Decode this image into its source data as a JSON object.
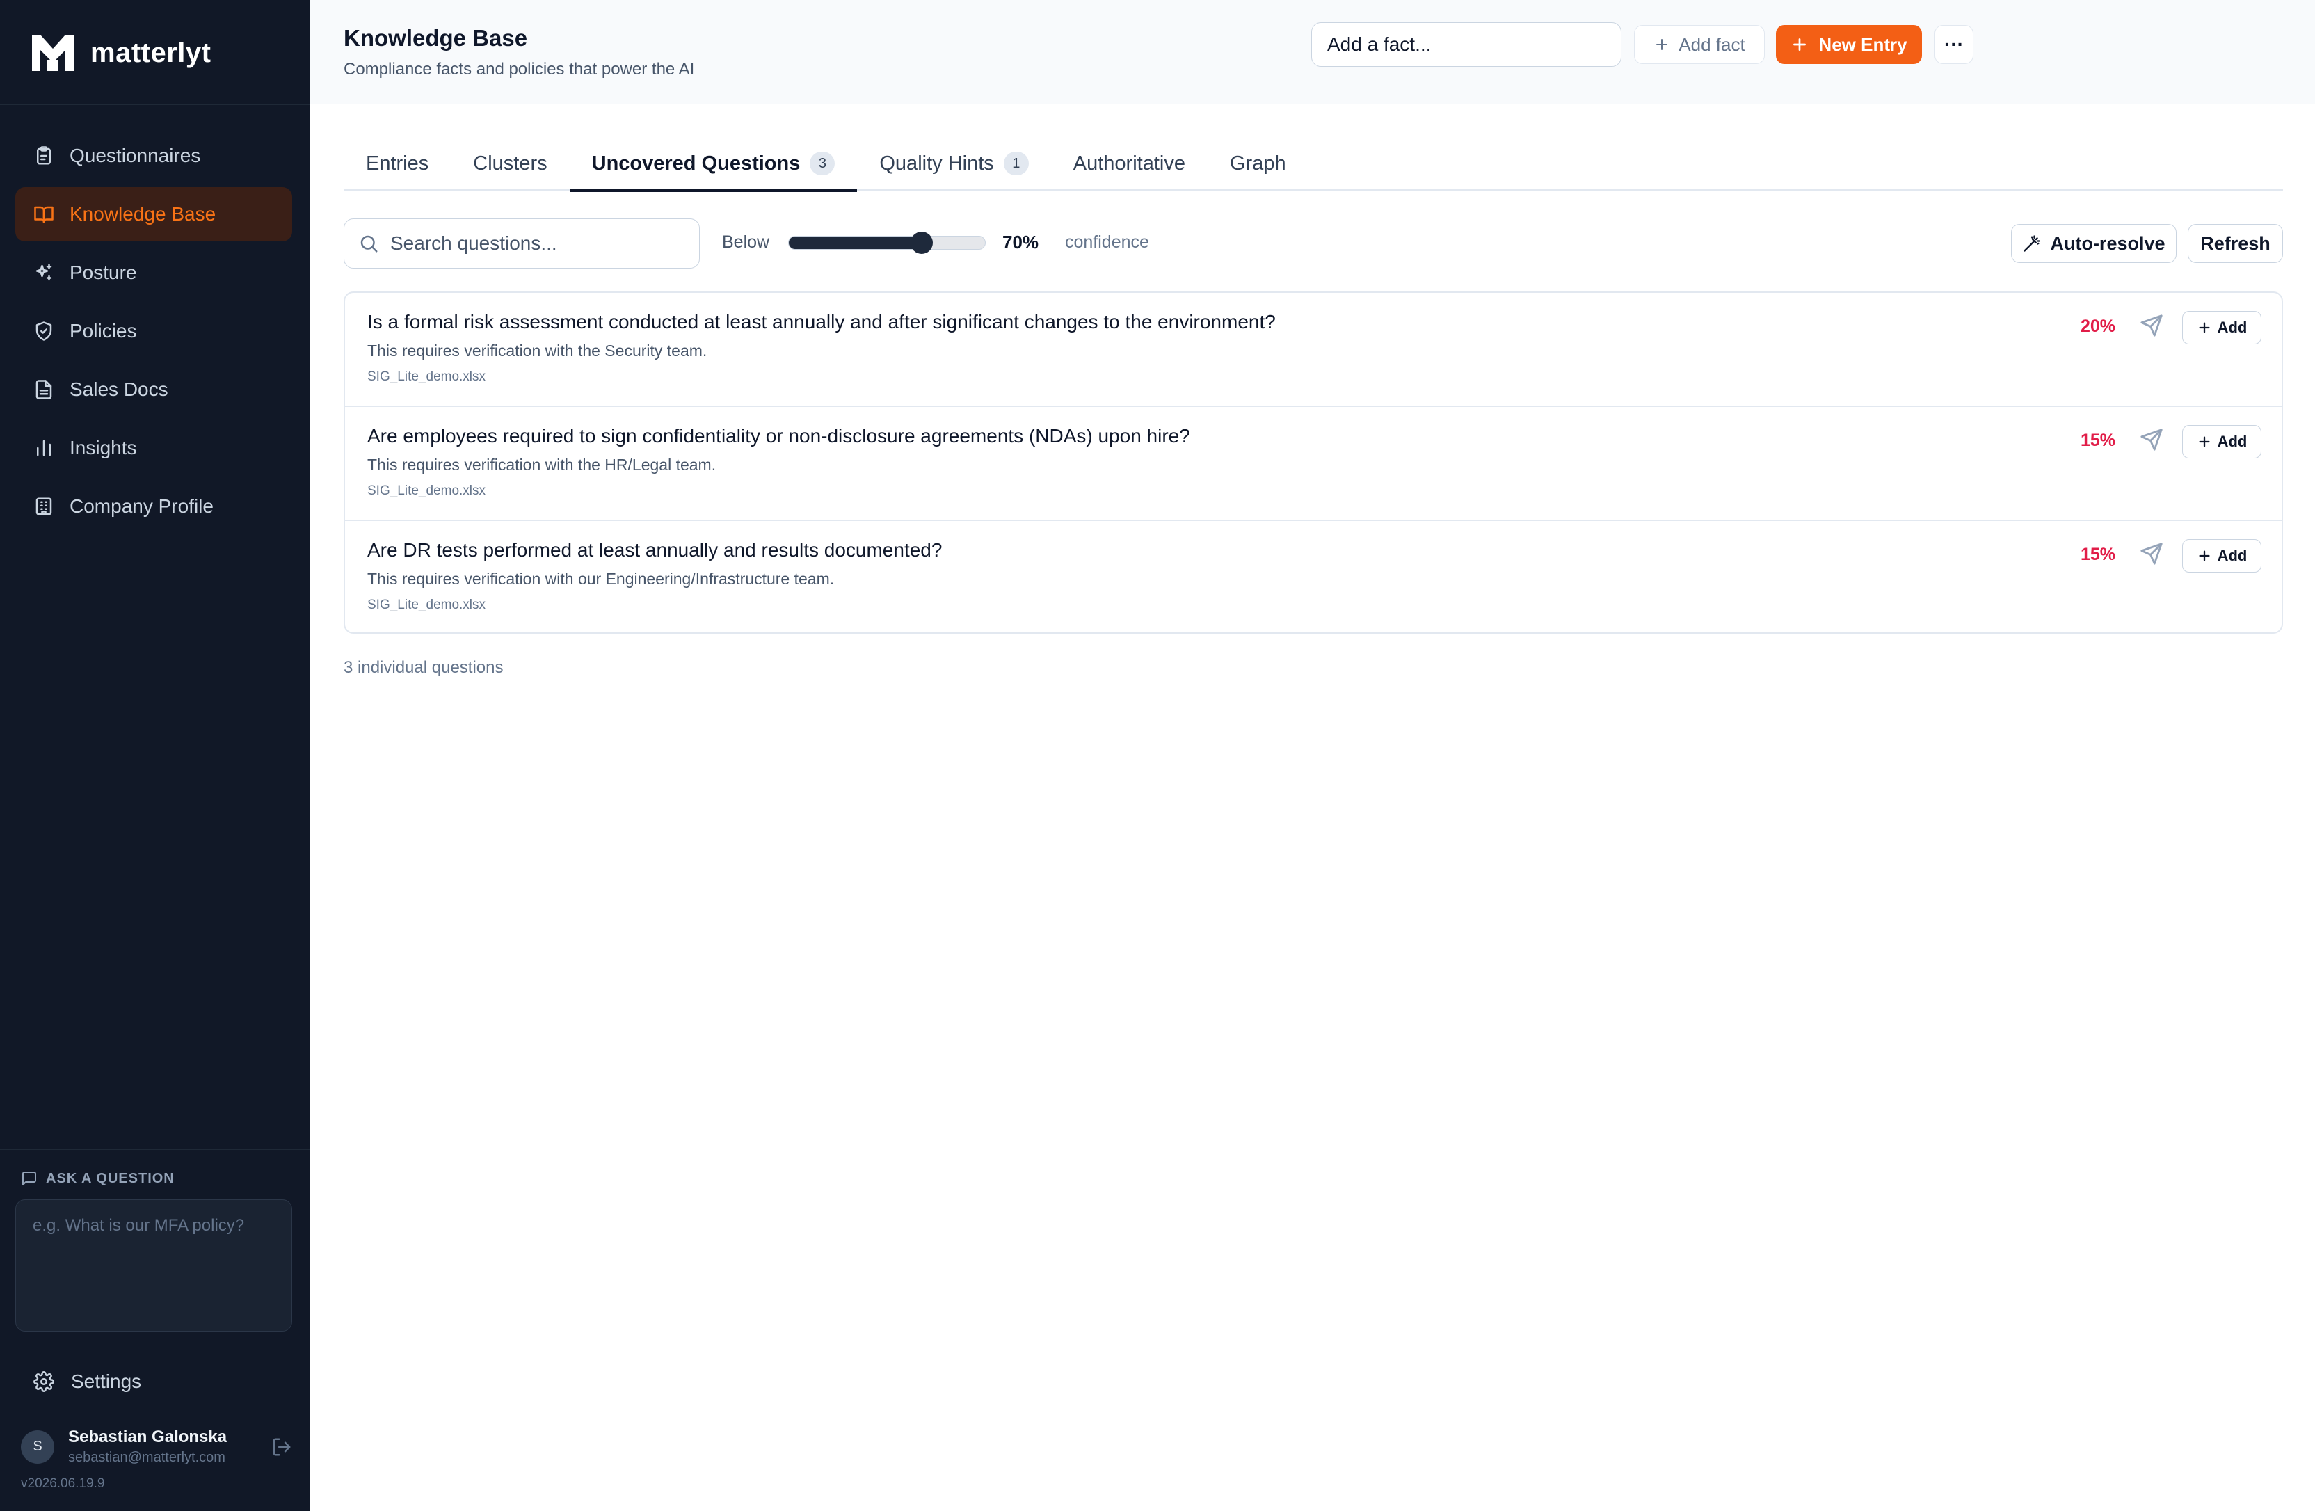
{
  "brand": {
    "name": "matterlyt"
  },
  "sidebar": {
    "items": [
      {
        "label": "Questionnaires",
        "icon": "clipboard-icon",
        "active": false
      },
      {
        "label": "Knowledge Base",
        "icon": "book-open-icon",
        "active": true
      },
      {
        "label": "Posture",
        "icon": "sparkles-icon",
        "active": false
      },
      {
        "label": "Policies",
        "icon": "shield-icon",
        "active": false
      },
      {
        "label": "Sales Docs",
        "icon": "file-text-icon",
        "active": false
      },
      {
        "label": "Insights",
        "icon": "bar-chart-icon",
        "active": false
      },
      {
        "label": "Company Profile",
        "icon": "building-icon",
        "active": false
      }
    ],
    "ask": {
      "label": "ASK A QUESTION",
      "placeholder": "e.g. What is our MFA policy?"
    },
    "settings_label": "Settings",
    "user": {
      "initial": "S",
      "name": "Sebastian Galonska",
      "email": "sebastian@matterlyt.com"
    },
    "version": "v2026.06.19.9"
  },
  "header": {
    "title": "Knowledge Base",
    "subtitle": "Compliance facts and policies that power the AI",
    "fact_placeholder": "Add a fact...",
    "add_fact_label": "Add fact",
    "new_entry_label": "New Entry",
    "more_label": "···"
  },
  "tabs": [
    {
      "label": "Entries",
      "badge": null,
      "active": false
    },
    {
      "label": "Clusters",
      "badge": null,
      "active": false
    },
    {
      "label": "Uncovered Questions",
      "badge": "3",
      "active": true
    },
    {
      "label": "Quality Hints",
      "badge": "1",
      "active": false
    },
    {
      "label": "Authoritative",
      "badge": null,
      "active": false
    },
    {
      "label": "Graph",
      "badge": null,
      "active": false
    }
  ],
  "toolbar": {
    "search_placeholder": "Search questions...",
    "below_label": "Below",
    "threshold_value": "70%",
    "threshold_fraction": 0.7,
    "confidence_label": "confidence",
    "auto_resolve_label": "Auto-resolve",
    "refresh_label": "Refresh"
  },
  "questions": [
    {
      "question": "Is a formal risk assessment conducted at least annually and after significant changes to the environment?",
      "note": "This requires verification with the Security team.",
      "source": "SIG_Lite_demo.xlsx",
      "confidence": "20%",
      "add_label": "Add"
    },
    {
      "question": "Are employees required to sign confidentiality or non-disclosure agreements (NDAs) upon hire?",
      "note": "This requires verification with the HR/Legal team.",
      "source": "SIG_Lite_demo.xlsx",
      "confidence": "15%",
      "add_label": "Add"
    },
    {
      "question": "Are DR tests performed at least annually and results documented?",
      "note": "This requires verification with our Engineering/Infrastructure team.",
      "source": "SIG_Lite_demo.xlsx",
      "confidence": "15%",
      "add_label": "Add"
    }
  ],
  "count_label": "3 individual questions",
  "colors": {
    "sidebar_bg": "#111827",
    "accent": "#f35f15",
    "low_confidence": "#e11d48"
  }
}
